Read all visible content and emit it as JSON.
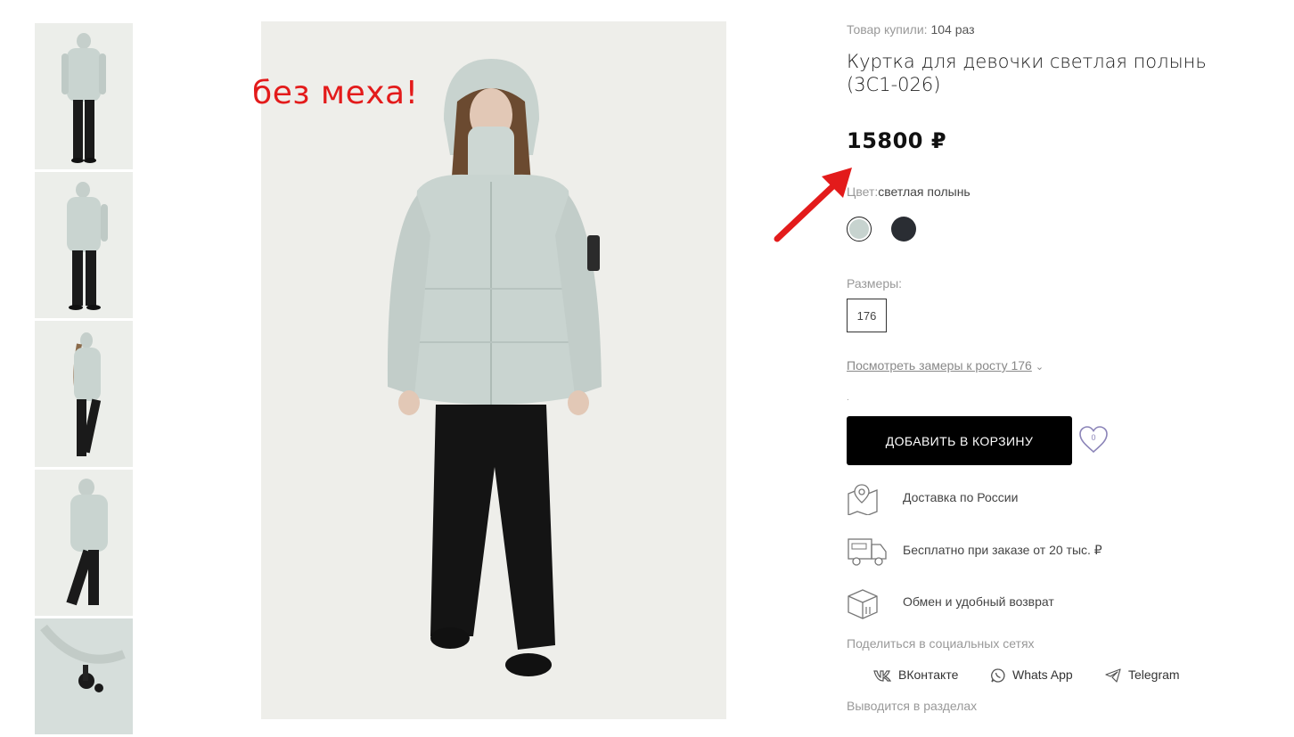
{
  "annotation": {
    "text": "без меха!"
  },
  "product": {
    "bought_label": "Товар купили:",
    "bought_count": "104 раз",
    "title": "Куртка для девочки светлая полынь (3С1-026)",
    "price": "15800 ₽",
    "color_label": "Цвет:",
    "color_value": "светлая полынь",
    "colors": [
      {
        "name": "светлая полынь",
        "hex": "#c7d3cf",
        "selected": true
      },
      {
        "name": "black",
        "hex": "#2a2d33",
        "selected": false
      }
    ],
    "sizes_label": "Размеры:",
    "sizes": [
      "176"
    ],
    "measure_link": "Посмотреть замеры к росту 176",
    "small_dot": ".",
    "add_to_cart": "ДОБАВИТЬ В КОРЗИНУ",
    "favorites_count": "0"
  },
  "features": [
    {
      "icon": "map-pin-icon",
      "text": "Доставка по России"
    },
    {
      "icon": "delivery-truck-icon",
      "text": "Бесплатно при заказе от 20 тыс. ₽"
    },
    {
      "icon": "return-box-icon",
      "text": "Обмен и удобный возврат"
    }
  ],
  "share": {
    "label": "Поделиться в социальных сетях",
    "items": [
      {
        "icon": "vk-icon",
        "label": "ВКонтакте"
      },
      {
        "icon": "whatsapp-icon",
        "label": "Whats App"
      },
      {
        "icon": "telegram-icon",
        "label": "Telegram"
      }
    ]
  },
  "sections_label": "Выводится в разделах",
  "colors": {
    "accent_red": "#e31b1b",
    "button_bg": "#000000",
    "heart": "#8b84b8"
  }
}
